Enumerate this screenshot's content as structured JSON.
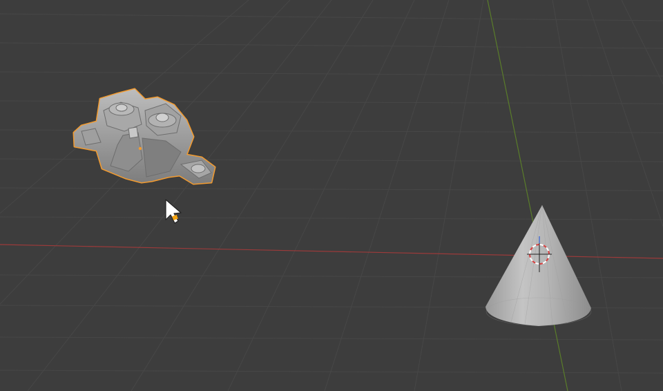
{
  "viewport": {
    "background_color": "#3d3d3d",
    "grid_color": "#464646",
    "x_axis_color": "#9c3a3a",
    "y_axis_color": "#5a7d2a",
    "selection_outline_color": "#f39b2f"
  },
  "scene": {
    "objects": [
      {
        "name": "Suzanne",
        "selected": true,
        "decimated": true
      },
      {
        "name": "Cone",
        "selected": false
      }
    ],
    "cursor": {
      "icon": "arrow-cursor-icon"
    },
    "origin_3d_cursor": {
      "icon": "3d-cursor-icon"
    }
  }
}
